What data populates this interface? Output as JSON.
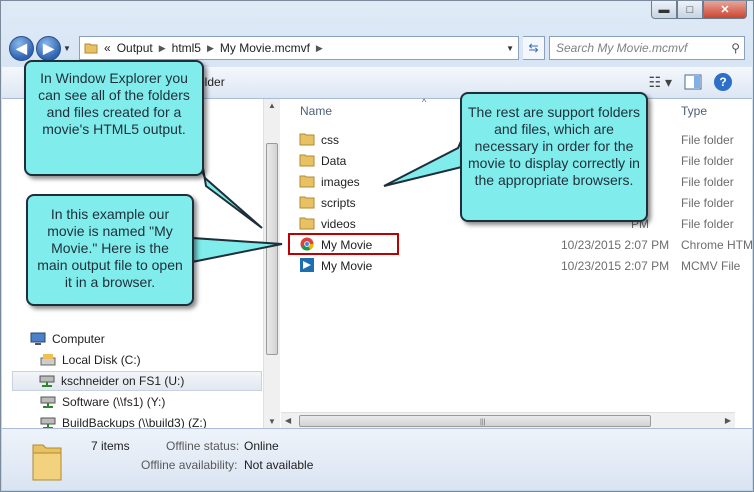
{
  "window": {
    "minimize": "▬",
    "maximize": "□",
    "close": "✕"
  },
  "address": {
    "prefix": "«",
    "crumbs": [
      "Output",
      "html5",
      "My Movie.mcmvf"
    ]
  },
  "search": {
    "placeholder": "Search My Movie.mcmvf"
  },
  "toolbar": {
    "partial_label": "older"
  },
  "columns": {
    "name": "Name",
    "type": "Type"
  },
  "files": [
    {
      "name": "css",
      "date": "",
      "type": "File folder",
      "icon": "folder-icon"
    },
    {
      "name": "Data",
      "date": "",
      "type": "File folder",
      "icon": "folder-icon"
    },
    {
      "name": "images",
      "date": "",
      "type": "File folder",
      "icon": "folder-icon"
    },
    {
      "name": "scripts",
      "date": "",
      "type": "File folder",
      "icon": "folder-icon"
    },
    {
      "name": "videos",
      "date": "",
      "type": "File folder",
      "icon": "folder-icon"
    },
    {
      "name": "My Movie",
      "date": "10/23/2015 2:07 PM",
      "type": "Chrome HTML",
      "icon": "chrome-icon"
    },
    {
      "name": "My Movie",
      "date": "10/23/2015 2:07 PM",
      "type": "MCMV File",
      "icon": "mcmv-file-icon"
    }
  ],
  "partial_dates": {
    "css": "PM",
    "Data": "PM",
    "images": "PM",
    "scripts": "PM",
    "videos": "PM"
  },
  "nav": {
    "computer": "Computer",
    "items": [
      {
        "label": "Local Disk (C:)",
        "icon": "local-disk-icon"
      },
      {
        "label": "kschneider on FS1 (U:)",
        "icon": "network-drive-icon"
      },
      {
        "label": "Software (\\\\fs1) (Y:)",
        "icon": "network-drive-icon"
      },
      {
        "label": "BuildBackups (\\\\build3) (Z:)",
        "icon": "network-drive-icon"
      }
    ]
  },
  "details": {
    "count": "7 items",
    "offline_status_label": "Offline status:",
    "offline_status_value": "Online",
    "offline_avail_label": "Offline availability:",
    "offline_avail_value": "Not available"
  },
  "callouts": {
    "explorer": "In Window Explorer you can see all of the folders and files created for a movie's HTML5 output.",
    "support": "The rest are support folders and files, which are necessary in order for the movie to display correctly in the appropriate browsers.",
    "main": "In this example our movie is named \"My Movie.\" Here is the main output file to open it in a browser."
  },
  "colors": {
    "callout_fill": "#80ecec",
    "highlight": "#c00000",
    "folder": "#e8c262"
  }
}
